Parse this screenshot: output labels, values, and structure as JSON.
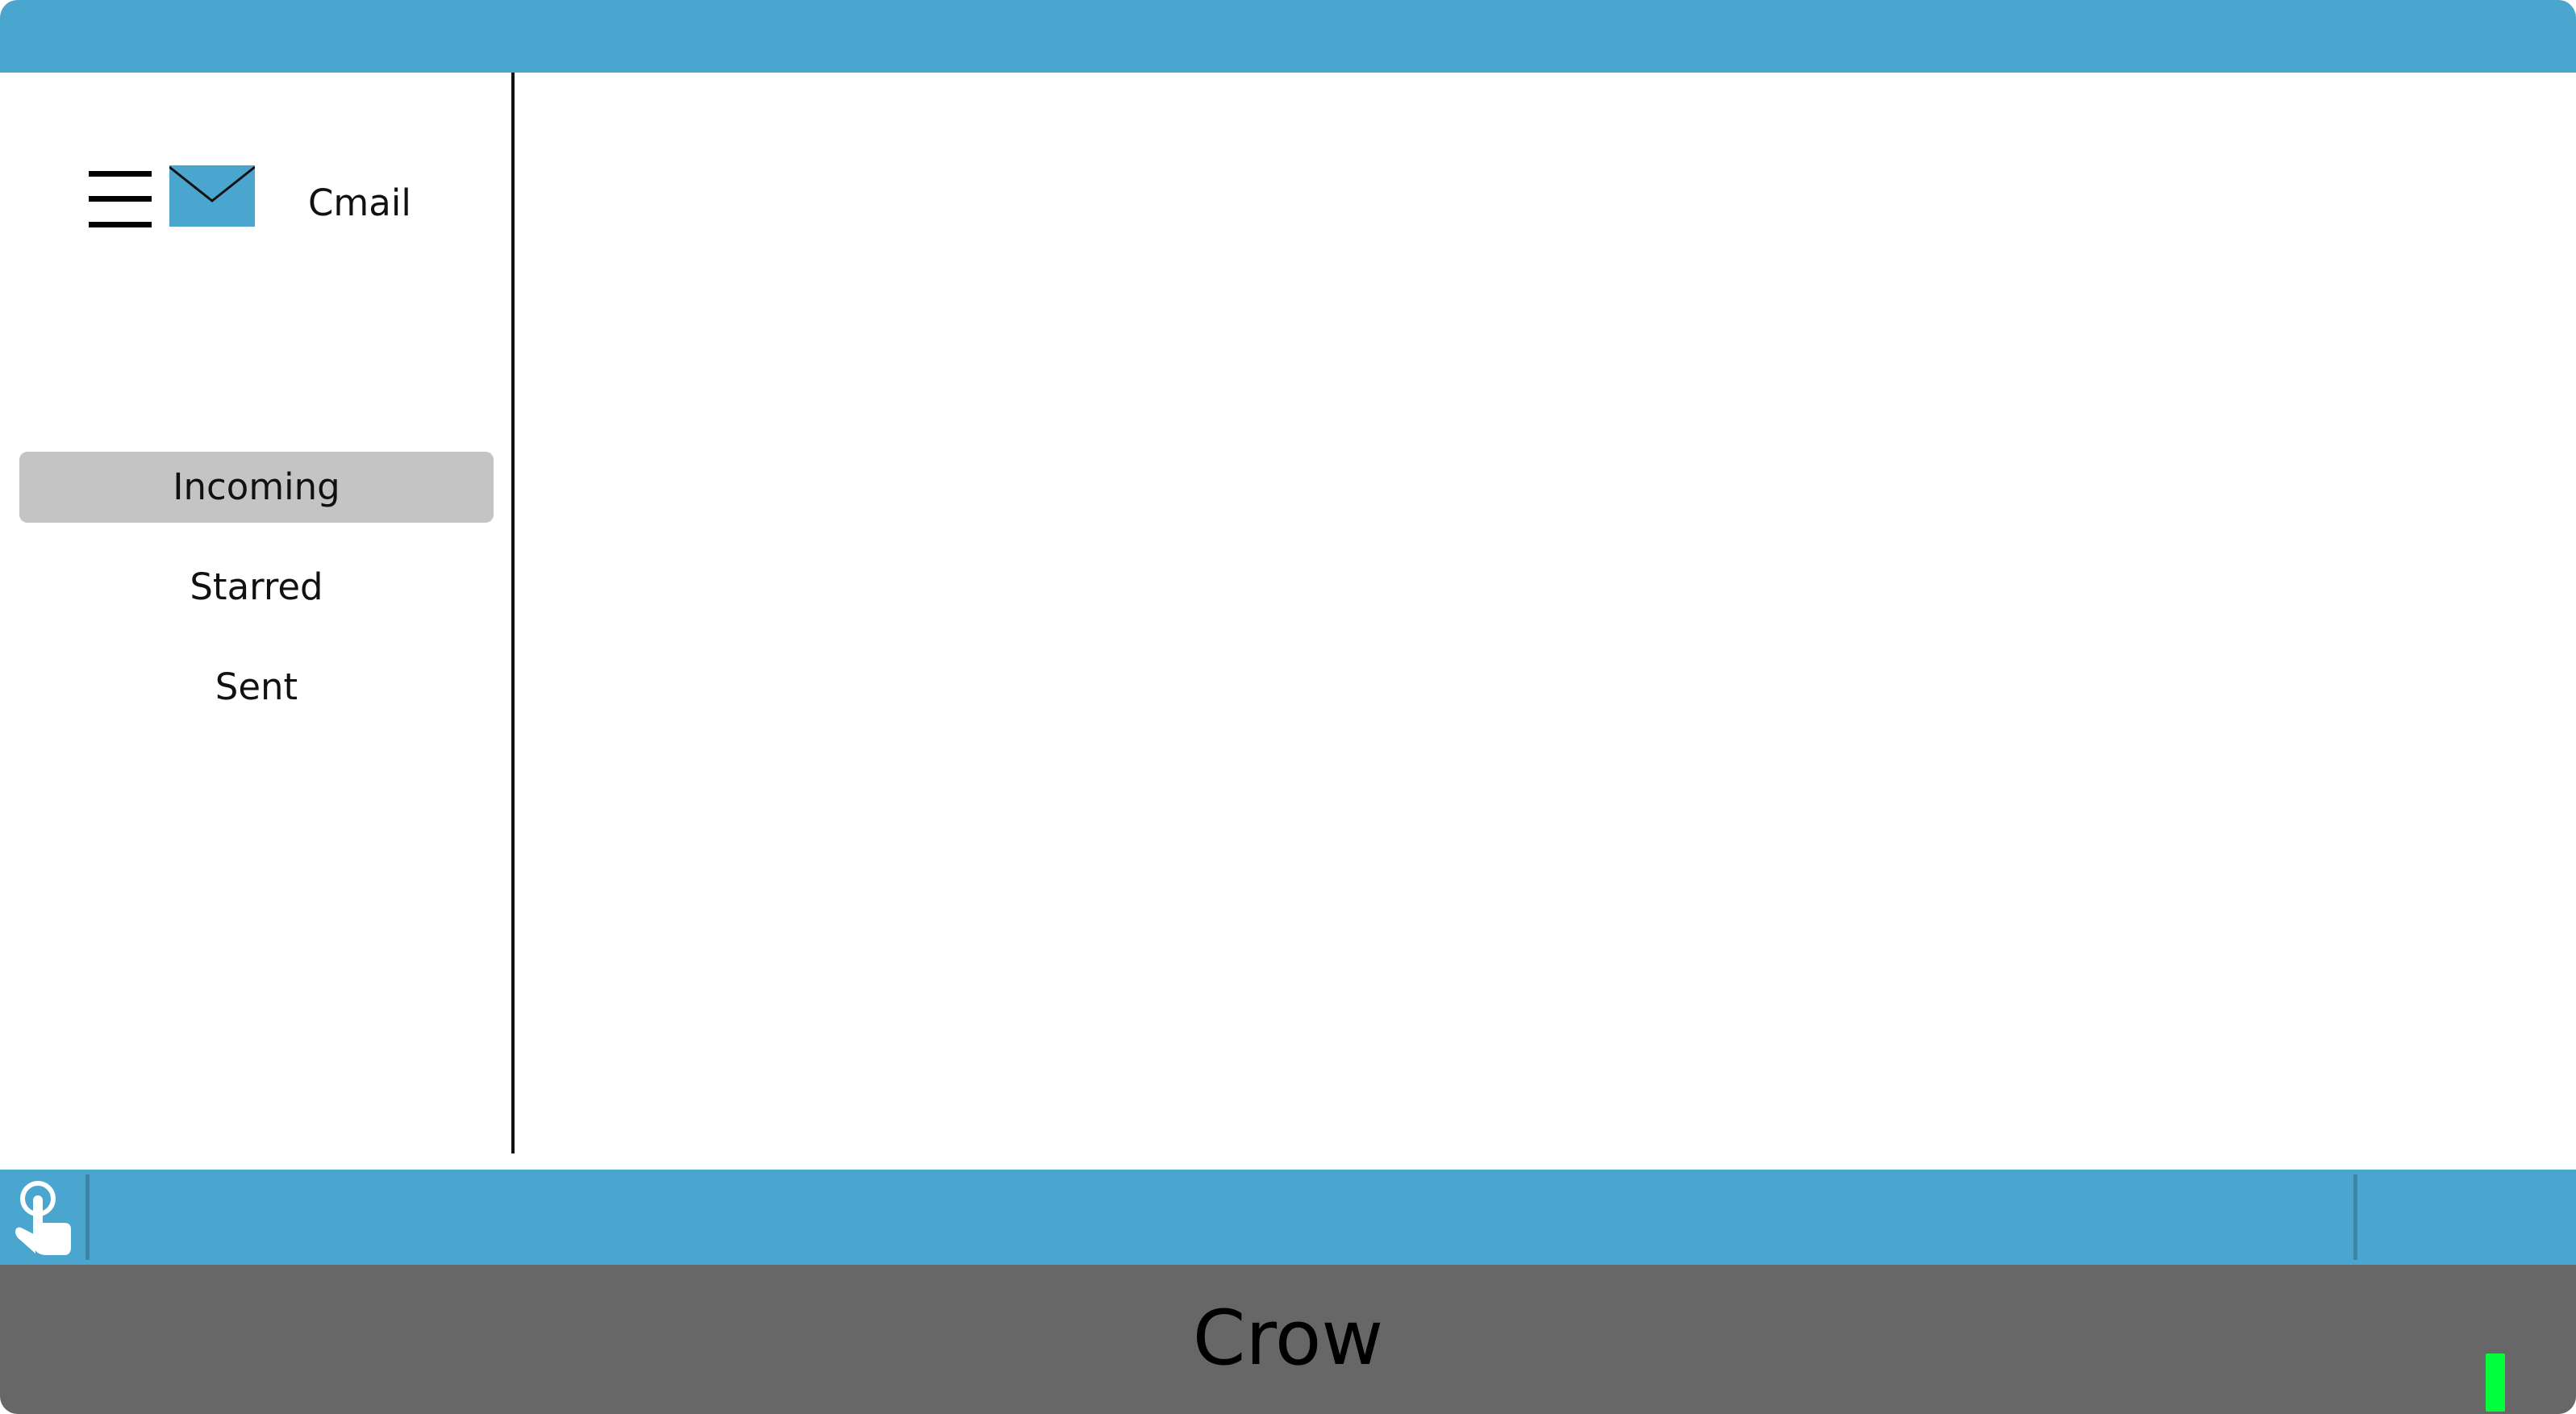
{
  "app": {
    "name": "Cmail",
    "menu_icon": "hamburger-menu-icon",
    "logo_icon": "envelope-icon",
    "accent_color": "#4aa6cf"
  },
  "sidebar": {
    "items": [
      {
        "label": "Incoming",
        "active": true
      },
      {
        "label": "Starred",
        "active": false
      },
      {
        "label": "Sent",
        "active": false
      }
    ]
  },
  "taskbar": {
    "touch_icon": "touch-hand-icon",
    "color": "#4aa6cf"
  },
  "footer": {
    "brand": "Crow",
    "background": "#676767",
    "status_color": "#00ff3c"
  }
}
